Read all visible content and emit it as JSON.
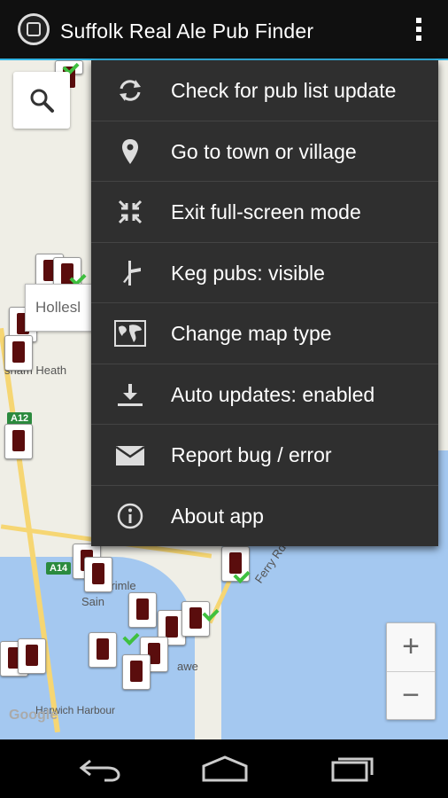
{
  "app": {
    "title": "Suffolk Real Ale Pub Finder",
    "logo_icon": "pub-finder-logo"
  },
  "menu": {
    "items": [
      {
        "label": "Check for pub list update",
        "icon": "sync-icon"
      },
      {
        "label": "Go to town or village",
        "icon": "location-pin-icon"
      },
      {
        "label": "Exit full-screen mode",
        "icon": "exit-fullscreen-icon"
      },
      {
        "label": "Keg pubs: visible",
        "icon": "keg-tap-icon"
      },
      {
        "label": "Change map type",
        "icon": "world-map-icon"
      },
      {
        "label": "Auto updates: enabled",
        "icon": "download-icon"
      },
      {
        "label": "Report bug / error",
        "icon": "envelope-icon"
      },
      {
        "label": "About app",
        "icon": "info-icon"
      }
    ]
  },
  "map": {
    "popup_label": "Hollesl",
    "place_labels": [
      "sham Heath",
      "Trimle",
      "Sain",
      "Harwich Harbour",
      "Ferry Rd",
      "awe"
    ],
    "road_shields": [
      "A12",
      "A14"
    ],
    "attribution": "Google",
    "zoom_in": "+",
    "zoom_out": "−"
  },
  "colors": {
    "accent": "#33b5e5",
    "menu_bg": "#2f2f2f",
    "sea": "#a4c8f0",
    "visited_check": "#3fc03f"
  }
}
